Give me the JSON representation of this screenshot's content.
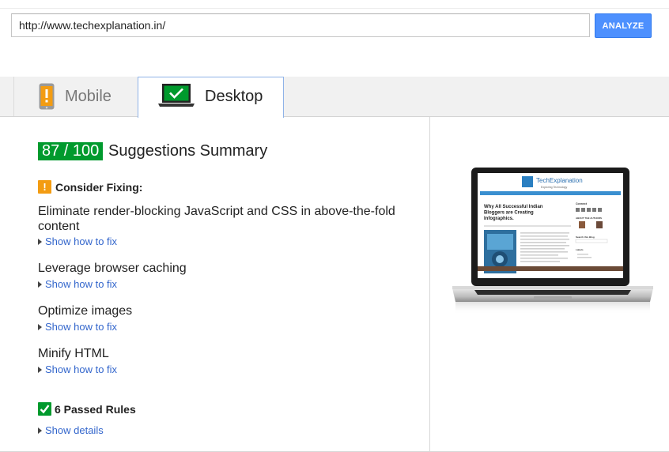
{
  "url_bar": {
    "value": "http://www.techexplanation.in/",
    "analyze_label": "ANALYZE"
  },
  "tabs": [
    {
      "label": "Mobile",
      "icon": "phone-warning-icon",
      "selected": false
    },
    {
      "label": "Desktop",
      "icon": "laptop-check-icon",
      "selected": true
    }
  ],
  "summary": {
    "score": "87 / 100",
    "title": "Suggestions Summary"
  },
  "consider_fixing": {
    "heading": "Consider Fixing:",
    "icon": "warning-icon",
    "rules": [
      {
        "title": "Eliminate render-blocking JavaScript and CSS in above-the-fold content",
        "link": "Show how to fix"
      },
      {
        "title": "Leverage browser caching",
        "link": "Show how to fix"
      },
      {
        "title": "Optimize images",
        "link": "Show how to fix"
      },
      {
        "title": "Minify HTML",
        "link": "Show how to fix"
      }
    ]
  },
  "passed": {
    "heading": "6 Passed Rules",
    "link": "Show details",
    "icon": "check-icon"
  },
  "preview": {
    "site_name": "TechExplanation",
    "site_tagline": "Exploring Technology",
    "post_title": "Why All Successful Indian Bloggers are Creating Infographics.",
    "sidebar_connect": "Connect",
    "sidebar_authors": "ABOUT THE AUTHORS",
    "sidebar_search": "Search this Blog",
    "sidebar_labels": "Labels"
  },
  "colors": {
    "accent": "#4d90fe",
    "score_green": "#009a2d",
    "warning": "#f39c12",
    "link": "#3366cc"
  }
}
